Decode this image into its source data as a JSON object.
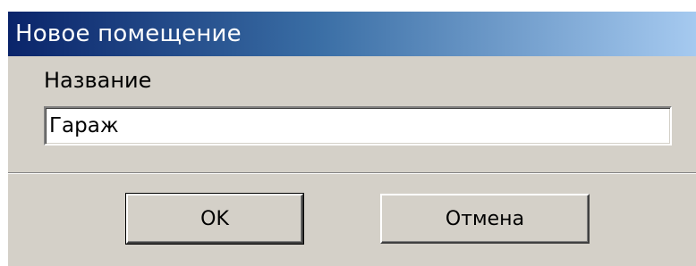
{
  "window": {
    "title": "Новое помещение"
  },
  "form": {
    "name_label": "Название",
    "name_value": "Гараж"
  },
  "buttons": {
    "ok_label": "OK",
    "cancel_label": "Отмена"
  },
  "colors": {
    "titlebar_start": "#0a246a",
    "titlebar_end": "#a6caf0",
    "dialog_face": "#d4d0c8"
  }
}
